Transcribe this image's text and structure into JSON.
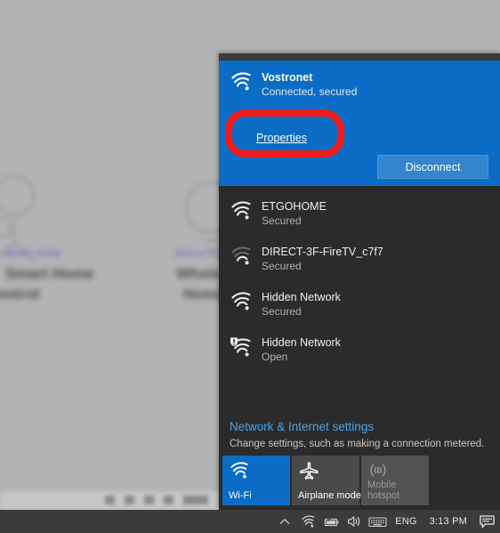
{
  "flyout": {
    "connected_network": {
      "ssid": "Vostronet",
      "status": "Connected, secured",
      "properties_label": "Properties",
      "disconnect_label": "Disconnect",
      "icon": "wifi-full-icon",
      "accent_color": "#0a6cc4"
    },
    "networks": [
      {
        "ssid": "ETGOHOME",
        "status": "Secured",
        "icon": "wifi-full-icon",
        "bars": 4
      },
      {
        "ssid": "DIRECT-3F-FireTV_c7f7",
        "status": "Secured",
        "icon": "wifi-weak-icon",
        "bars": 2
      },
      {
        "ssid": "Hidden Network",
        "status": "Secured",
        "icon": "wifi-full-icon",
        "bars": 4
      },
      {
        "ssid": "Hidden Network",
        "status": "Open",
        "icon": "wifi-open-warning-icon",
        "bars": 4
      }
    ],
    "settings": {
      "link_label": "Network & Internet settings",
      "description": "Change settings, such as making a connection metered.",
      "link_color": "#4aa3e8"
    },
    "tiles": [
      {
        "label": "Wi-Fi",
        "icon": "wifi-icon",
        "state": "on"
      },
      {
        "label": "Airplane mode",
        "icon": "airplane-icon",
        "state": "off"
      },
      {
        "label": "Mobile hotspot",
        "icon": "hotspot-icon",
        "state": "disabled"
      }
    ]
  },
  "annotation": {
    "shape": "red-rounded-rectangle",
    "color": "#f21b1b",
    "targets": "Properties"
  },
  "taskbar": {
    "items": [
      {
        "name": "show-hidden-icons",
        "icon": "chevron-up-icon",
        "type": "icon"
      },
      {
        "name": "network-tray",
        "icon": "wifi-icon",
        "type": "icon"
      },
      {
        "name": "battery-tray",
        "icon": "battery-icon",
        "type": "icon"
      },
      {
        "name": "volume-tray",
        "icon": "speaker-icon",
        "type": "icon"
      },
      {
        "name": "keyboard-tray",
        "icon": "keyboard-icon",
        "type": "icon"
      }
    ],
    "language": "ENG",
    "time": "3:13 PM",
    "action_center_icon": "action-center-icon",
    "background_color": "#3b3b3b"
  },
  "background": {
    "cards": [
      {
        "eyebrow": "SMART HOME",
        "title_line1": "Smart Home",
        "title_line2": "Control"
      },
      {
        "eyebrow": "WHOLE HOME",
        "title_line1": "Whole",
        "title_line2": "Home"
      }
    ]
  }
}
